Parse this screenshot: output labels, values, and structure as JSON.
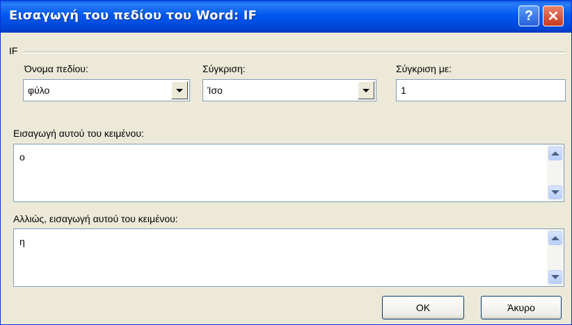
{
  "dialog": {
    "title": "Εισαγωγή του πεδίου του Word: IF",
    "help_glyph": "?",
    "close_glyph": "✕"
  },
  "group": {
    "label": "IF"
  },
  "field_name": {
    "label": "Όνομα πεδίου:",
    "value": "φύλο"
  },
  "comparison": {
    "label": "Σύγκριση:",
    "value": "Ίσο"
  },
  "compare_to": {
    "label": "Σύγκριση με:",
    "value": "1"
  },
  "insert_text": {
    "label": "Εισαγωγή αυτού του κειμένου:",
    "value": "ο"
  },
  "otherwise_text": {
    "label": "Αλλιώς, εισαγωγή αυτού του κειμένου:",
    "value": "η"
  },
  "buttons": {
    "ok": "OK",
    "cancel": "Άκυρο"
  },
  "colors": {
    "title_bar": "#0058ee",
    "dialog_bg": "#ece9d8",
    "close_button": "#c8381b"
  }
}
